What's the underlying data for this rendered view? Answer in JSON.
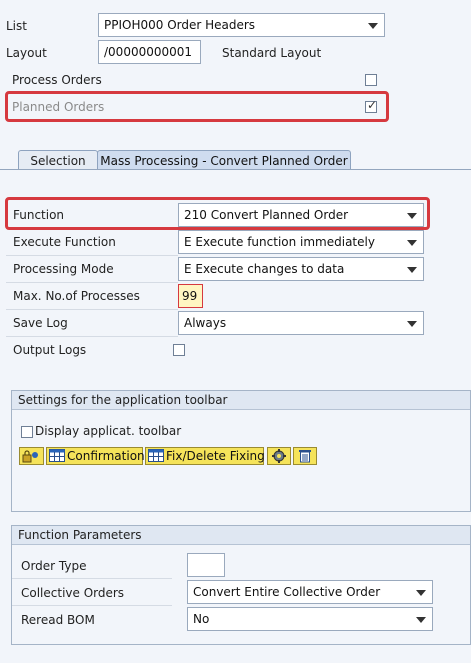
{
  "top": {
    "list_label": "List",
    "list_value": "PPIOH000 Order Headers",
    "layout_label": "Layout",
    "layout_value": "/00000000001",
    "layout_desc": "Standard Layout",
    "process_orders_label": "Process Orders",
    "process_orders_checked": false,
    "planned_orders_label": "Planned Orders",
    "planned_orders_checked": true
  },
  "tabs": [
    {
      "label": "Selection",
      "active": false
    },
    {
      "label": "Mass Processing - Convert Planned Order",
      "active": true
    }
  ],
  "mass": {
    "function_label": "Function",
    "function_value": "210 Convert Planned Order",
    "execute_label": "Execute Function",
    "execute_value": "E Execute function immediately",
    "processing_label": "Processing Mode",
    "processing_value": "E Execute changes to data",
    "max_label": "Max. No.of Processes",
    "max_value": "99",
    "savelog_label": "Save Log",
    "savelog_value": "Always",
    "output_label": "Output Logs",
    "output_checked": false
  },
  "toolbar_group": {
    "title": "Settings for the application toolbar",
    "display_label": "Display applicat. toolbar",
    "display_checked": false,
    "buttons": {
      "confirmation": "Confirmation",
      "fixdelete": "Fix/Delete Fixing"
    }
  },
  "params_group": {
    "title": "Function Parameters",
    "order_type_label": "Order Type",
    "order_type_value": "",
    "collective_label": "Collective Orders",
    "collective_value": "Convert Entire Collective Order",
    "reread_label": "Reread BOM",
    "reread_value": "No"
  },
  "colors": {
    "highlight": "#d6393f",
    "button_yellow": "#f5e35a",
    "tab_active": "#cfdcef"
  }
}
